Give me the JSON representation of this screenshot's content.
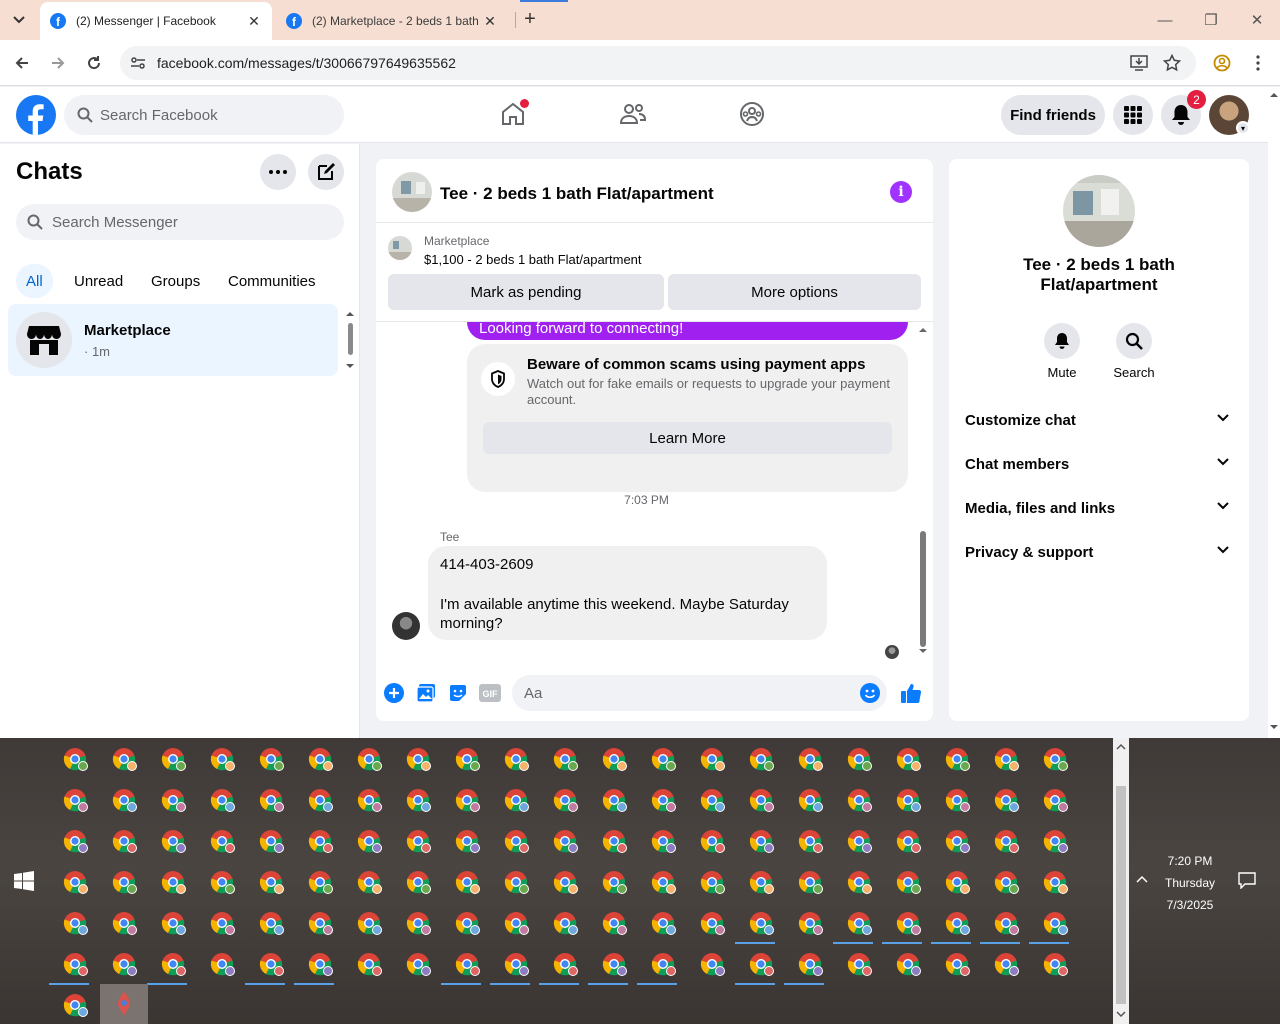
{
  "browser": {
    "tabs": [
      {
        "title": "(2) Messenger | Facebook",
        "active": true
      },
      {
        "title": "(2) Marketplace - 2 beds 1 bath",
        "active": false
      }
    ],
    "url": "facebook.com/messages/t/30066797649635562"
  },
  "fb_header": {
    "search_placeholder": "Search Facebook",
    "find_friends": "Find friends",
    "notifications_count": "2"
  },
  "chats": {
    "title": "Chats",
    "search_placeholder": "Search Messenger",
    "filters": [
      "All",
      "Unread",
      "Groups",
      "Communities"
    ],
    "items": [
      {
        "name": "Marketplace",
        "time": "· 1m"
      }
    ]
  },
  "conversation": {
    "title": "Tee · 2 beds 1 bath Flat/apartment",
    "marketplace_label": "Marketplace",
    "listing": "$1,100 - 2 beds 1 bath Flat/apartment",
    "mark_pending": "Mark as pending",
    "more_options": "More options",
    "prev_message": "Looking forward to connecting!",
    "scam_title": "Beware of common scams using payment apps",
    "scam_body": "Watch out for fake emails or requests to upgrade your payment account.",
    "learn_more": "Learn More",
    "timestamp": "7:03 PM",
    "sender": "Tee",
    "message_line1": "414-403-2609",
    "message_line2": "I'm available anytime this weekend. Maybe Saturday morning?",
    "composer_placeholder": "Aa"
  },
  "info_panel": {
    "title": "Tee · 2 beds 1 bath Flat/apartment",
    "mute": "Mute",
    "search": "Search",
    "sections": [
      "Customize chat",
      "Chat members",
      "Media, files and links",
      "Privacy & support"
    ]
  },
  "taskbar": {
    "time": "7:20 PM",
    "day": "Thursday",
    "date": "7/3/2025"
  },
  "colors": {
    "fb_blue": "#1877f2",
    "messenger_purple": "#a020f0",
    "badge_red": "#e41e3f"
  }
}
